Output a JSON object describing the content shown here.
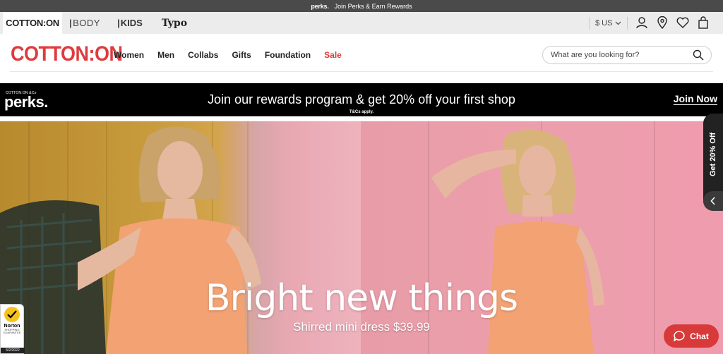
{
  "promo_top": {
    "brand": "perks.",
    "text": "Join Perks & Earn Rewards"
  },
  "brand_tabs": [
    {
      "label": "COTTON:ON"
    },
    {
      "label": "BODY"
    },
    {
      "label": "KIDS"
    },
    {
      "label": "Typo"
    }
  ],
  "utility": {
    "currency": "$ US"
  },
  "header": {
    "logo": "COTTON:ON",
    "nav": [
      "Women",
      "Men",
      "Collabs",
      "Gifts",
      "Foundation",
      "Sale"
    ],
    "search_placeholder": "What are you looking for?"
  },
  "perks_banner": {
    "logo_small": "COTTON:ON &Co",
    "logo": "perks.",
    "text": "Join our rewards program & get 20% off your first shop",
    "terms": "T&Cs apply.",
    "cta": "Join Now"
  },
  "hero": {
    "title": "Bright new things",
    "subtitle": "Shirred mini dress $39.99"
  },
  "side_tab": {
    "label": "Get 20% Off"
  },
  "norton": {
    "brand": "Norton",
    "sub": "SHOPPING GUARANTEE",
    "date": "5/2/2022"
  },
  "chat": {
    "label": "Chat"
  },
  "colors": {
    "brand_red": "#e03a3e",
    "chat_red": "#d83a3a",
    "banner_black": "#000000"
  }
}
